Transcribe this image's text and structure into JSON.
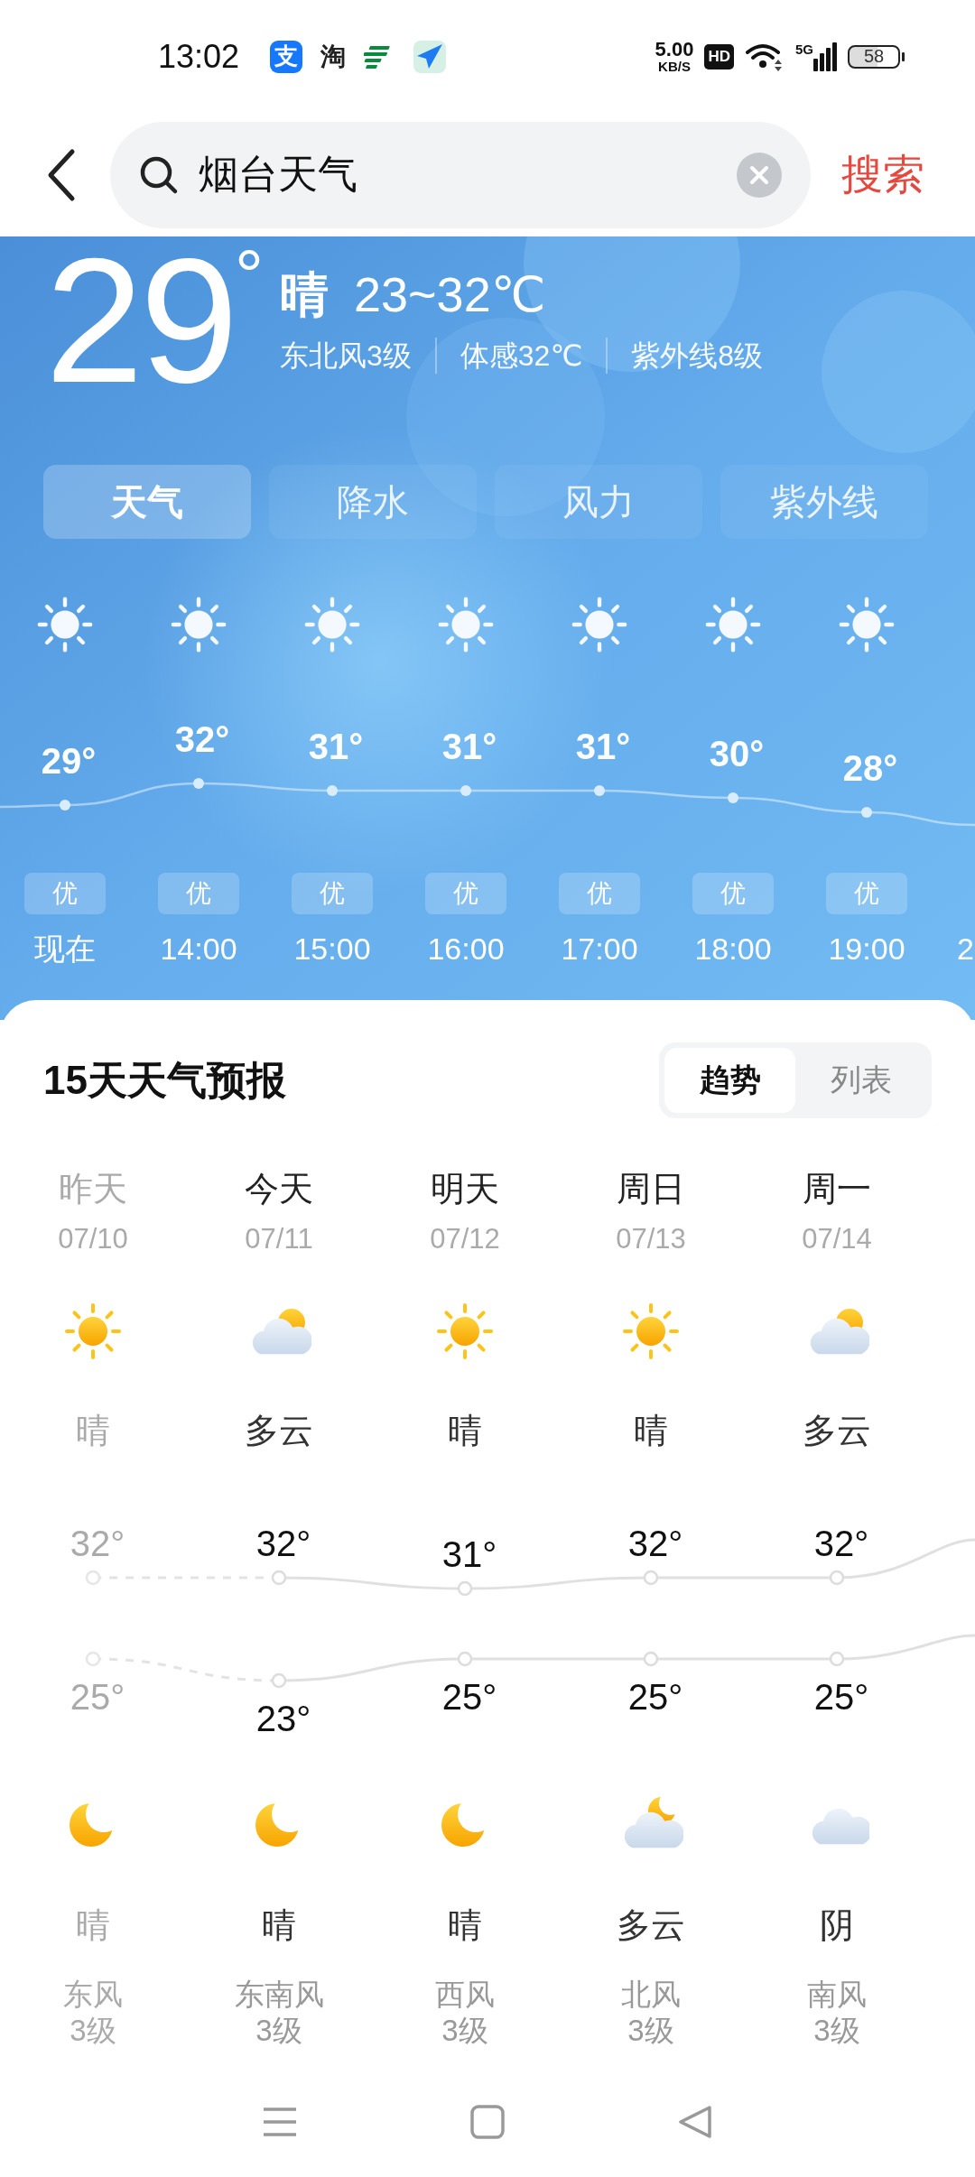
{
  "status_bar": {
    "time": "13:02",
    "apps": [
      {
        "kind": "pay",
        "glyph": "支"
      },
      {
        "kind": "shop",
        "glyph": "淘"
      },
      {
        "kind": "post"
      },
      {
        "kind": "plane"
      }
    ],
    "net_speed": "5.00",
    "net_unit": "KB/S",
    "hd": "HD",
    "network": "5G",
    "battery": "58"
  },
  "search": {
    "value": "烟台天气",
    "action": "搜索"
  },
  "current": {
    "temp": "29$^{°}$",
    "condition": "晴",
    "range": "23~32℃",
    "details": [
      "东北风3级",
      "体感32℃",
      "紫外线8级"
    ]
  },
  "tabs": [
    {
      "label": "天气",
      "selected": true
    },
    {
      "label": "降水",
      "selected": false
    },
    {
      "label": "风力",
      "selected": false
    },
    {
      "label": "紫外线",
      "selected": false
    }
  ],
  "hourly": [
    {
      "kind": "hour",
      "temp": "29°",
      "aqi": "优",
      "time": "现在"
    },
    {
      "kind": "hour",
      "temp": "32°",
      "aqi": "优",
      "time": "14:00"
    },
    {
      "kind": "hour",
      "temp": "31°",
      "aqi": "优",
      "time": "15:00"
    },
    {
      "kind": "hour",
      "temp": "31°",
      "aqi": "优",
      "time": "16:00"
    },
    {
      "kind": "hour",
      "temp": "31°",
      "aqi": "优",
      "time": "17:00"
    },
    {
      "kind": "hour",
      "temp": "30°",
      "aqi": "优",
      "time": "18:00"
    },
    {
      "kind": "hour",
      "temp": "28°",
      "aqi": "优",
      "time": "19:00"
    },
    {
      "kind": "partial",
      "time": "2"
    }
  ],
  "forecast": {
    "title": "15天天气预报",
    "views": [
      {
        "label": "趋势",
        "selected": true
      },
      {
        "label": "列表",
        "selected": false
      }
    ],
    "days": [
      {
        "day": "昨天",
        "date": "07/10",
        "past": true,
        "daytime": {
          "kind": "sun",
          "condition": "晴"
        },
        "high": "32°",
        "low": "25°",
        "night": {
          "kind": "moon",
          "condition": "晴"
        },
        "wind": "东风",
        "wind_level": "3级"
      },
      {
        "day": "今天",
        "date": "07/11",
        "past": false,
        "daytime": {
          "kind": "cloud-sun",
          "condition": "多云"
        },
        "high": "32°",
        "low": "23°",
        "night": {
          "kind": "moon",
          "condition": "晴"
        },
        "wind": "东南风",
        "wind_level": "3级"
      },
      {
        "day": "明天",
        "date": "07/12",
        "past": false,
        "daytime": {
          "kind": "sun",
          "condition": "晴"
        },
        "high": "31°",
        "low": "25°",
        "night": {
          "kind": "moon",
          "condition": "晴"
        },
        "wind": "西风",
        "wind_level": "3级"
      },
      {
        "day": "周日",
        "date": "07/13",
        "past": false,
        "daytime": {
          "kind": "sun",
          "condition": "晴"
        },
        "high": "32°",
        "low": "25°",
        "night": {
          "kind": "cloud-moon",
          "condition": "多云"
        },
        "wind": "北风",
        "wind_level": "3级"
      },
      {
        "day": "周一",
        "date": "07/14",
        "past": false,
        "daytime": {
          "kind": "cloud-sun",
          "condition": "多云"
        },
        "high": "32°",
        "low": "25°",
        "night": {
          "kind": "cloud",
          "condition": "阴"
        },
        "wind": "南风",
        "wind_level": "3级"
      }
    ]
  }
}
